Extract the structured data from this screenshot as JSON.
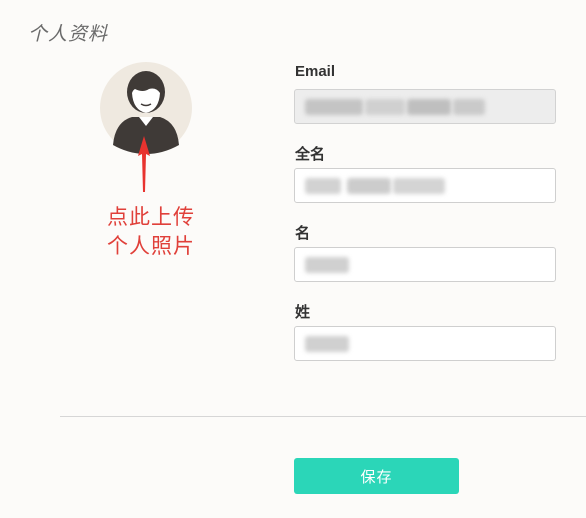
{
  "page": {
    "title": "个人资料"
  },
  "avatar": {
    "icon": "user-avatar-icon",
    "colors": {
      "circle_bg": "#efe9e0",
      "figure": "#3f3a37",
      "face": "#ffffff"
    }
  },
  "annotation": {
    "line1": "点此上传",
    "line2": "个人照片",
    "color": "#e0403a"
  },
  "form": {
    "email": {
      "label": "Email",
      "value": "",
      "readonly": true
    },
    "full_name": {
      "label": "全名",
      "value": ""
    },
    "first_name": {
      "label": "名",
      "value": ""
    },
    "last_name": {
      "label": "姓",
      "value": ""
    }
  },
  "actions": {
    "save_label": "保存",
    "save_color": "#2bd6b8"
  }
}
